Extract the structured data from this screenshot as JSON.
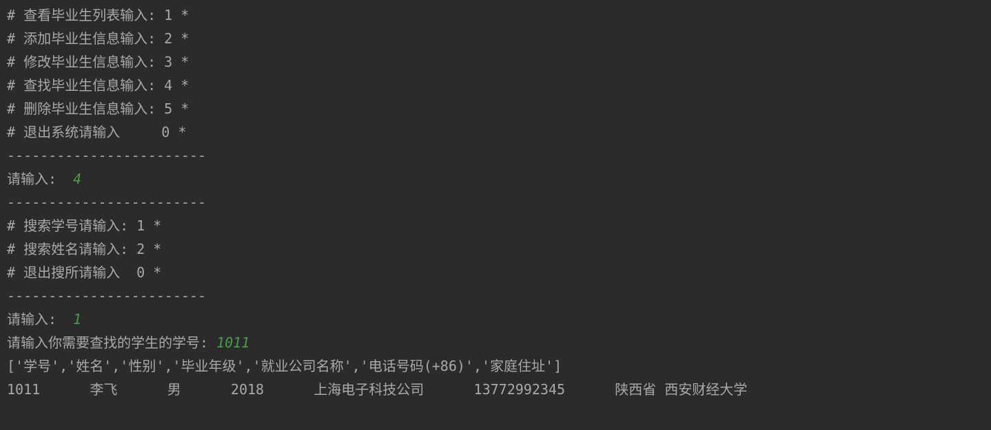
{
  "menu": {
    "items": [
      "# 查看毕业生列表输入: 1 *",
      "# 添加毕业生信息输入: 2 *",
      "# 修改毕业生信息输入: 3 *",
      "# 查找毕业生信息输入: 4 *",
      "# 删除毕业生信息输入: 5 *",
      "# 退出系统请输入     0 *"
    ],
    "divider": "------------------------"
  },
  "prompt1": {
    "label": "请输入:  ",
    "value": "4"
  },
  "submenu": {
    "divider_top": "------------------------",
    "items": [
      "# 搜索学号请输入: 1 *",
      "# 搜索姓名请输入: 2 *",
      "# 退出搜所请输入  0 *"
    ],
    "divider_bottom": "------------------------"
  },
  "prompt2": {
    "label": "请输入:  ",
    "value": "1"
  },
  "prompt3": {
    "label": "请输入你需要查找的学生的学号: ",
    "value": "1011"
  },
  "headers": "['学号','姓名','性别','毕业年级','就业公司名称','电话号码(+86)','家庭住址']",
  "result": {
    "id": "1011",
    "name": "李飞",
    "gender": "男",
    "year": "2018",
    "company": "上海电子科技公司",
    "phone": "13772992345",
    "address": "陕西省 西安财经大学",
    "formatted": "1011      李飞      男      2018      上海电子科技公司      13772992345      陕西省 西安财经大学"
  }
}
